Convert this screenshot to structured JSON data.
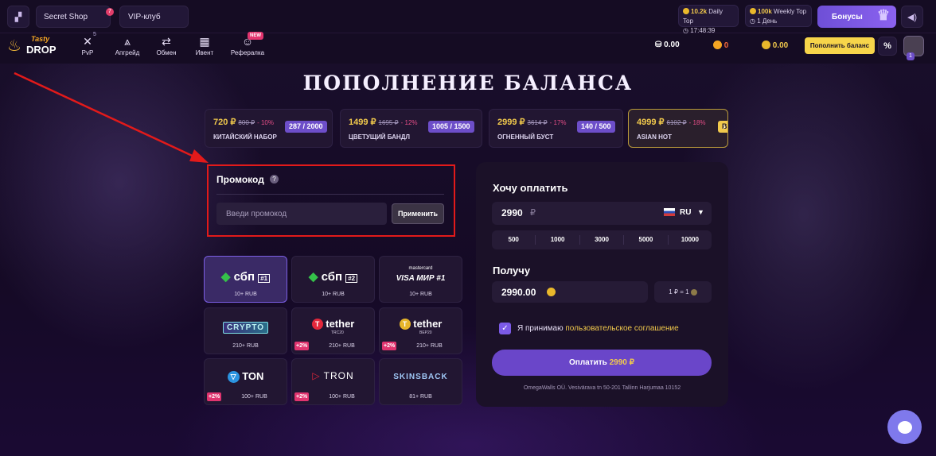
{
  "header": {
    "secret_shop": "Secret Shop",
    "secret_badge": "7",
    "vip": "VIP-клуб",
    "daily": {
      "amount": "10.2k",
      "label": "Daily Top",
      "time": "17:48:39"
    },
    "weekly": {
      "amount": "100k",
      "label": "Weekly Top",
      "time": "1 День"
    },
    "bonus": "Бонусы"
  },
  "brand": {
    "line1": "Tasty",
    "line2": "DROP"
  },
  "nav": [
    {
      "label": "PvP",
      "badge": "5",
      "icon": "swords-icon"
    },
    {
      "label": "Апгрейд",
      "icon": "upgrade-icon"
    },
    {
      "label": "Обмен",
      "icon": "exchange-icon"
    },
    {
      "label": "Ивент",
      "icon": "calendar-icon"
    },
    {
      "label": "Рефералка",
      "badge": "NEW",
      "icon": "referral-icon"
    }
  ],
  "wallet": {
    "balance": "0.00",
    "coins": "0",
    "points": "0.00",
    "topup": "Пополнить баланс",
    "percent": "%",
    "level": "1"
  },
  "page_title": "ПОПОЛНЕНИЕ БАЛАНСА",
  "offers": [
    {
      "price": "720 ₽",
      "old": "800 ₽",
      "discount": "- 10%",
      "name": "КИТАЙСКИЙ НАБОР",
      "count": "287 / 2000"
    },
    {
      "price": "1499 ₽",
      "old": "1695 ₽",
      "discount": "- 12%",
      "name": "ЦВЕТУЩИЙ БАНДЛ",
      "count": "1005 / 1500"
    },
    {
      "price": "2999 ₽",
      "old": "3614 ₽",
      "discount": "- 17%",
      "name": "ОГНЕННЫЙ БУСТ",
      "count": "140 / 500"
    },
    {
      "price": "4999 ₽",
      "old": "6102 ₽",
      "discount": "- 18%",
      "name": "ASIAN HOT",
      "count": "B"
    }
  ],
  "promo": {
    "title": "Промокод",
    "help": "?",
    "placeholder": "Введи промокод",
    "apply": "Применить"
  },
  "methods": [
    {
      "logo": "сбп",
      "tag": "#1",
      "sub": "10+ RUB"
    },
    {
      "logo": "сбп",
      "tag": "#2",
      "sub": "10+ RUB"
    },
    {
      "logo_top": "mastercard",
      "logo": "VISA МИР",
      "tag": "#1",
      "sub": "10+ RUB"
    },
    {
      "logo": "CRYPTO",
      "sub": "210+ RUB"
    },
    {
      "logo": "tether",
      "net": "TRC20",
      "plus": "+2%",
      "sub": "210+ RUB"
    },
    {
      "logo": "tether",
      "net": "BEP20",
      "plus": "+2%",
      "sub": "210+ RUB"
    },
    {
      "logo": "TON",
      "plus": "+2%",
      "sub": "100+ RUB"
    },
    {
      "logo": "TRON",
      "plus": "+2%",
      "sub": "100+ RUB"
    },
    {
      "logo": "SKINSBACK",
      "sub": "81+ RUB"
    }
  ],
  "payment": {
    "pay_label": "Хочу оплатить",
    "amount": "2990",
    "currency_symbol": "₽",
    "currency": "RU",
    "presets": [
      "500",
      "1000",
      "3000",
      "5000",
      "10000"
    ],
    "receive_label": "Получу",
    "receive_amount": "2990.00",
    "rate": "1 ₽ = 1",
    "agree_prefix": "Я принимаю",
    "agree_link": "пользовательское соглашение",
    "pay_button": "Оплатить",
    "pay_amount": "2990 ₽",
    "footer": "OmegaWalls OÜ. Vesivärava tn 50-201 Tallinn Harjumaa 10152"
  },
  "colors": {
    "accent": "#6a46c9",
    "gold": "#f1c94c",
    "highlight": "#e21a1a"
  }
}
